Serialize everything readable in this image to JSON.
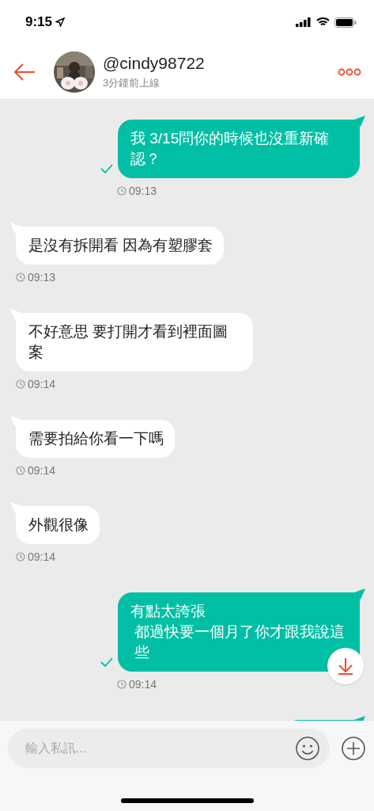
{
  "status_bar": {
    "time": "9:15"
  },
  "header": {
    "username": "@cindy98722",
    "status": "3分鐘前上線"
  },
  "messages": [
    {
      "kind": "sent",
      "lines": [
        "我 3/15問你的時候也沒重新確認？"
      ],
      "time": "09:13",
      "delivered": true
    },
    {
      "kind": "received",
      "lines": [
        "是沒有拆開看 因為有塑膠套"
      ],
      "time": "09:13",
      "delivered": false
    },
    {
      "kind": "received",
      "lines": [
        "不好意思 要打開才看到裡面圖案"
      ],
      "time": "09:14",
      "delivered": false
    },
    {
      "kind": "received",
      "lines": [
        "需要拍給你看一下嗎"
      ],
      "time": "09:14",
      "delivered": false
    },
    {
      "kind": "received",
      "lines": [
        "外觀很像"
      ],
      "time": "09:14",
      "delivered": false
    },
    {
      "kind": "sent",
      "lines": [
        "有點太誇張",
        "都過快要一個月了你才跟我說這些"
      ],
      "time": "09:14",
      "delivered": true
    },
    {
      "kind": "cutoff"
    }
  ],
  "composer": {
    "placeholder": "輸入私訊..."
  }
}
